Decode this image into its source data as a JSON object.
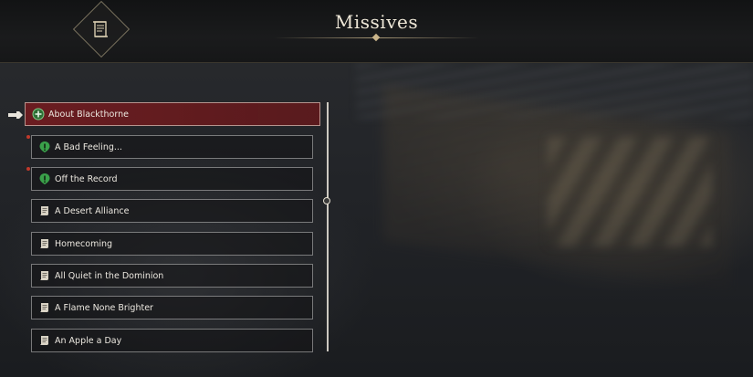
{
  "header": {
    "title": "Missives",
    "emblem_icon": "scroll-icon"
  },
  "missives": [
    {
      "label": "About Blackthorne",
      "icon": "quest-plus-icon",
      "selected": true,
      "unread": false
    },
    {
      "label": "A Bad Feeling...",
      "icon": "quest-exclamation-icon",
      "selected": false,
      "unread": true
    },
    {
      "label": "Off the Record",
      "icon": "quest-exclamation-icon",
      "selected": false,
      "unread": true
    },
    {
      "label": "A Desert Alliance",
      "icon": "scroll-icon",
      "selected": false,
      "unread": false
    },
    {
      "label": "Homecoming",
      "icon": "scroll-icon",
      "selected": false,
      "unread": false
    },
    {
      "label": "All Quiet in the Dominion",
      "icon": "scroll-icon",
      "selected": false,
      "unread": false
    },
    {
      "label": "A Flame None Brighter",
      "icon": "scroll-icon",
      "selected": false,
      "unread": false
    },
    {
      "label": "An Apple a Day",
      "icon": "scroll-icon",
      "selected": false,
      "unread": false
    }
  ],
  "colors": {
    "selected": "#6e1c20",
    "unread_dot": "#c0392b",
    "quest_green": "#3aa04a"
  }
}
